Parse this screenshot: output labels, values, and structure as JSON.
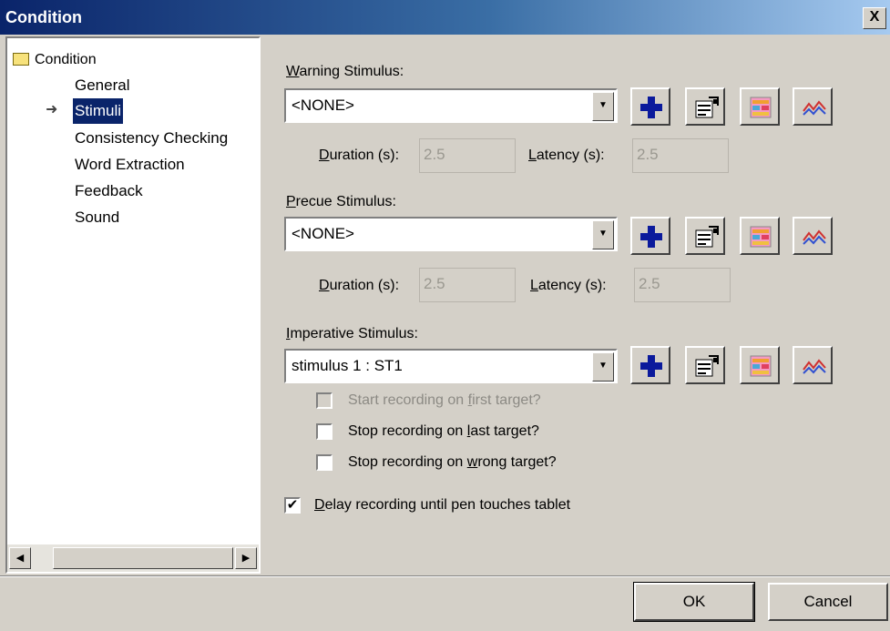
{
  "window": {
    "title": "Condition",
    "close_glyph": "X"
  },
  "tree": {
    "root_label": "Condition",
    "items": [
      {
        "label": "General",
        "selected": false
      },
      {
        "label": "Stimuli",
        "selected": true
      },
      {
        "label": "Consistency Checking",
        "selected": false
      },
      {
        "label": "Word Extraction",
        "selected": false
      },
      {
        "label": "Feedback",
        "selected": false
      },
      {
        "label": "Sound",
        "selected": false
      }
    ]
  },
  "warning": {
    "label_access": "W",
    "label_rest": "arning Stimulus:",
    "value": "<NONE>",
    "duration_access": "D",
    "duration_rest": "uration (s):",
    "duration": "2.5",
    "latency_access": "L",
    "latency_rest": "atency (s):",
    "latency": "2.5"
  },
  "precue": {
    "label_access": "P",
    "label_rest": "recue Stimulus:",
    "value": "<NONE>",
    "duration_access": "D",
    "duration_rest": "uration (s):",
    "duration": "2.5",
    "latency_access": "L",
    "latency_rest": "atency (s):",
    "latency": "2.5"
  },
  "imperative": {
    "label_access": "I",
    "label_rest": "mperative Stimulus:",
    "value": "stimulus 1 : ST1"
  },
  "checkboxes": {
    "start_first": {
      "pre": "Start recording on ",
      "access": "f",
      "post": "irst target?",
      "checked": false,
      "disabled": true
    },
    "stop_last": {
      "pre": "Stop recording on ",
      "access": "l",
      "post": "ast target?",
      "checked": false
    },
    "stop_wrong": {
      "pre": "Stop recording on ",
      "access": "w",
      "post": "rong target?",
      "checked": false
    },
    "delay_pen": {
      "access": "D",
      "post": "elay recording until pen touches tablet",
      "checked": true,
      "mark": "✔"
    }
  },
  "buttons": {
    "ok": "OK",
    "cancel": "Cancel"
  },
  "icons": [
    "add-stimulus-icon",
    "edit-stimulus-icon",
    "stimulus-preview-icon",
    "stimulus-graph-icon"
  ],
  "colors": {
    "title_start": "#0a246a",
    "title_end": "#a6caf0",
    "plus_blue": "#0b1a9c",
    "selection": "#0a246a"
  }
}
